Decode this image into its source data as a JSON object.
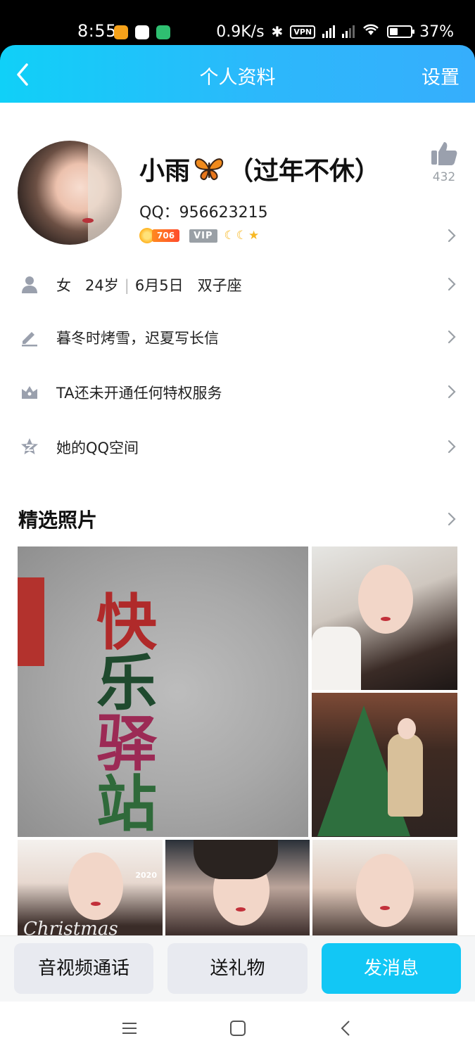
{
  "status_bar": {
    "time": "8:55",
    "net_speed": "0.9K/s",
    "vpn": "VPN",
    "battery": "37%"
  },
  "header": {
    "title": "个人资料",
    "settings": "设置"
  },
  "profile": {
    "name": "小雨",
    "name_suffix": "（过年不休）",
    "like_count": "432",
    "qq_number": "QQ：956623215",
    "level": "706",
    "vip": "VIP"
  },
  "info_rows": {
    "gender": "女",
    "age": "24岁",
    "separator": "|",
    "birthday": "6月5日",
    "zodiac": "双子座",
    "signature": "暮冬时烤雪，迟夏写长信",
    "privilege": "TA还未开通任何特权服务",
    "qzone": "她的QQ空间"
  },
  "photos": {
    "section_title": "精选照片",
    "big_photo_chars": [
      "快",
      "乐",
      "驿",
      "站"
    ],
    "photo_text_christmas": "Christmas",
    "photo_text_year": "2020"
  },
  "actions": {
    "call": "音视频通话",
    "gift": "送礼物",
    "message": "发消息"
  },
  "colors": {
    "header_start": "#10d0f8",
    "header_end": "#36aefc",
    "primary_button": "#12c7f5",
    "icon_gray": "#9aa0ad"
  }
}
